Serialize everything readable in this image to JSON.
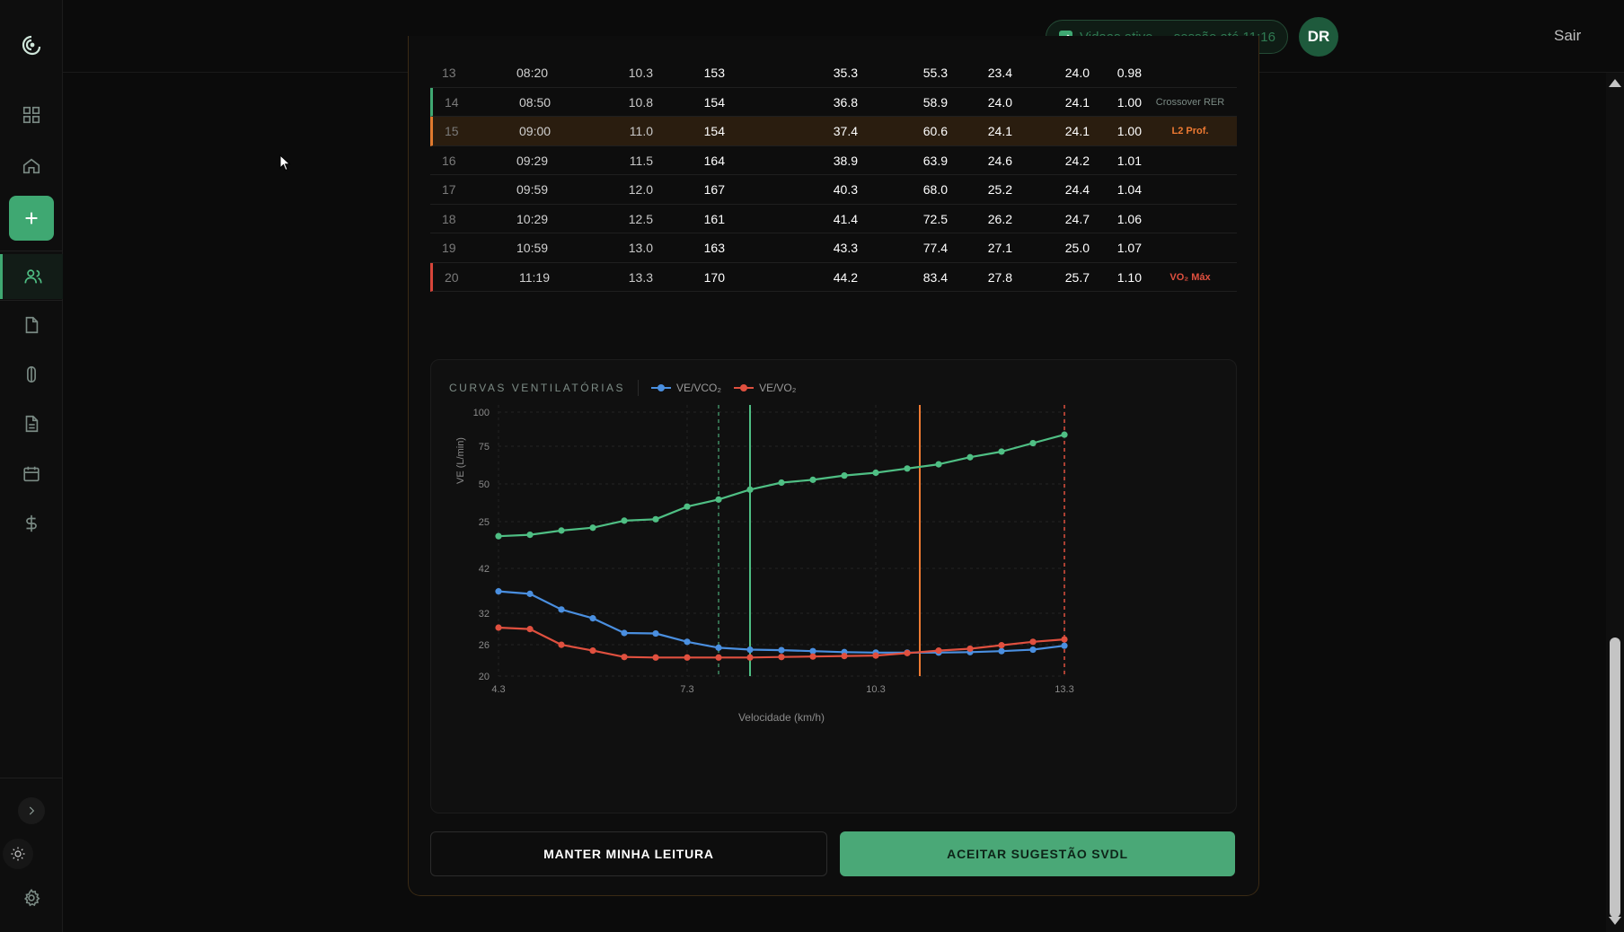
{
  "header": {
    "session_text": "Vidaas ativo — sessão até 11:16",
    "avatar_initials": "DR",
    "logout_label": "Sair"
  },
  "sidebar": {
    "items": [
      {
        "name": "dashboard",
        "icon": "grid-icon"
      },
      {
        "name": "home",
        "icon": "home-icon"
      },
      {
        "name": "new",
        "icon": "plus-icon"
      },
      {
        "name": "patients",
        "icon": "users-icon",
        "active": true
      },
      {
        "name": "files",
        "icon": "file-icon"
      },
      {
        "name": "capsule",
        "icon": "capsule-icon"
      },
      {
        "name": "reports",
        "icon": "document-icon"
      },
      {
        "name": "calendar",
        "icon": "calendar-icon"
      },
      {
        "name": "finance",
        "icon": "dollar-icon"
      }
    ]
  },
  "table": {
    "rows": [
      {
        "n": "13",
        "time": "08:20",
        "speed": "10.3",
        "hr": "153",
        "vo2": "35.3",
        "ve": "55.3",
        "eq_o2": "23.4",
        "eq_co2": "24.0",
        "rer": "0.98",
        "tag": "",
        "mark": ""
      },
      {
        "n": "14",
        "time": "08:50",
        "speed": "10.8",
        "hr": "154",
        "vo2": "36.8",
        "ve": "58.9",
        "eq_o2": "24.0",
        "eq_co2": "24.1",
        "rer": "1.00",
        "tag": "Crossover RER",
        "mark": "l"
      },
      {
        "n": "15",
        "time": "09:00",
        "speed": "11.0",
        "hr": "154",
        "vo2": "37.4",
        "ve": "60.6",
        "eq_o2": "24.1",
        "eq_co2": "24.1",
        "rer": "1.00",
        "tag": "L2 Prof.",
        "mark": "o"
      },
      {
        "n": "16",
        "time": "09:29",
        "speed": "11.5",
        "hr": "164",
        "vo2": "38.9",
        "ve": "63.9",
        "eq_o2": "24.6",
        "eq_co2": "24.2",
        "rer": "1.01",
        "tag": "",
        "mark": ""
      },
      {
        "n": "17",
        "time": "09:59",
        "speed": "12.0",
        "hr": "167",
        "vo2": "40.3",
        "ve": "68.0",
        "eq_o2": "25.2",
        "eq_co2": "24.4",
        "rer": "1.04",
        "tag": "",
        "mark": ""
      },
      {
        "n": "18",
        "time": "10:29",
        "speed": "12.5",
        "hr": "161",
        "vo2": "41.4",
        "ve": "72.5",
        "eq_o2": "26.2",
        "eq_co2": "24.7",
        "rer": "1.06",
        "tag": "",
        "mark": ""
      },
      {
        "n": "19",
        "time": "10:59",
        "speed": "13.0",
        "hr": "163",
        "vo2": "43.3",
        "ve": "77.4",
        "eq_o2": "27.1",
        "eq_co2": "25.0",
        "rer": "1.07",
        "tag": "",
        "mark": ""
      },
      {
        "n": "20",
        "time": "11:19",
        "speed": "13.3",
        "hr": "170",
        "vo2": "44.2",
        "ve": "83.4",
        "eq_o2": "27.8",
        "eq_co2": "25.7",
        "rer": "1.10",
        "tag": "VO₂ Máx",
        "mark": "r"
      }
    ]
  },
  "chart": {
    "title": "CURVAS VENTILATÓRIAS",
    "legend_co2": "VE/VCO₂",
    "legend_o2": "VE/VO₂",
    "ylabel": "VE (L/min)",
    "xlabel": "Velocidade (km/h)"
  },
  "chart_data": {
    "type": "line",
    "x": [
      4.3,
      5.3,
      6.3,
      6.8,
      7.3,
      8.3,
      8.8,
      9.3,
      10.3,
      10.8,
      11.3,
      11.8,
      12.3,
      12.8,
      13.3
    ],
    "x_ticks": [
      "4.3",
      "7.3",
      "10.3",
      "13.3"
    ],
    "xlim": [
      4.3,
      13.3
    ],
    "panels": [
      {
        "y_ticks": [
          "100",
          "75",
          "50",
          "25"
        ],
        "ylim": [
          0,
          100
        ],
        "series": [
          {
            "key": "ve",
            "color": "#4fbf84",
            "x": [
              4.3,
              4.8,
              5.3,
              5.8,
              6.3,
              6.8,
              7.3,
              7.8,
              8.3,
              8.8,
              9.3,
              9.8,
              10.3,
              10.8,
              11.3,
              11.8,
              12.3,
              12.8,
              13.3
            ],
            "values": [
              12,
              13,
              16,
              18,
              23,
              24,
              33,
              38,
              45,
              50,
              52,
              55,
              57,
              60,
              63,
              68,
              72,
              78,
              84
            ]
          }
        ]
      },
      {
        "y_ticks": [
          "42",
          "32",
          "26",
          "20"
        ],
        "ylim": [
          20,
          42
        ],
        "series": [
          {
            "name": "VE/VCO₂",
            "color": "#4a8fe0",
            "x": [
              4.3,
              4.8,
              5.3,
              5.8,
              6.3,
              6.8,
              7.3,
              7.8,
              8.3,
              8.8,
              9.3,
              9.8,
              10.3,
              10.8,
              11.3,
              11.8,
              12.3,
              12.8,
              13.3
            ],
            "values": [
              37.3,
              36.8,
              33.6,
              31.8,
              28.8,
              28.7,
              27.0,
              25.8,
              25.4,
              25.3,
              25.1,
              24.9,
              24.8,
              24.8,
              24.8,
              24.9,
              25.1,
              25.4,
              26.2
            ]
          },
          {
            "name": "VE/VO₂",
            "color": "#e0503f",
            "x": [
              4.3,
              4.8,
              5.3,
              5.8,
              6.3,
              6.8,
              7.3,
              7.8,
              8.3,
              8.8,
              9.3,
              9.8,
              10.3,
              10.8,
              11.3,
              11.8,
              12.3,
              12.8,
              13.3
            ],
            "values": [
              29.9,
              29.6,
              26.4,
              25.2,
              23.9,
              23.8,
              23.8,
              23.8,
              23.8,
              23.9,
              24.0,
              24.1,
              24.2,
              24.7,
              25.2,
              25.6,
              26.3,
              27.0,
              27.5
            ]
          }
        ]
      }
    ],
    "markers": [
      {
        "x": 7.8,
        "color": "#3f8a62",
        "style": "dashed"
      },
      {
        "x": 8.3,
        "color": "#4fbf84",
        "style": "solid"
      },
      {
        "x": 11.0,
        "color": "#ee7a32",
        "style": "solid"
      },
      {
        "x": 13.3,
        "color": "#e0503f",
        "style": "dashed"
      }
    ],
    "grid": true
  },
  "buttons": {
    "keep_label": "MANTER MINHA LEITURA",
    "accept_label": "ACEITAR SUGESTÃO SVDL"
  },
  "colors": {
    "accent": "#3fa872",
    "l2_marker": "#ee7a32",
    "vo2max_marker": "#e0503f"
  }
}
